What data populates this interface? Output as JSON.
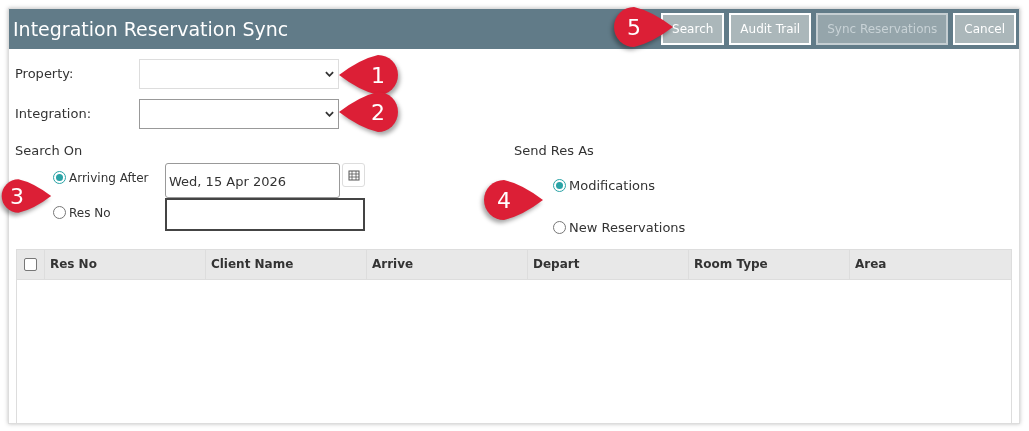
{
  "window": {
    "title": "Integration Reservation Sync"
  },
  "toolbar": [
    {
      "label": "Search",
      "disabled": false
    },
    {
      "label": "Audit Trail",
      "disabled": false
    },
    {
      "label": "Sync Reservations",
      "disabled": true
    },
    {
      "label": "Cancel",
      "disabled": false
    }
  ],
  "fields": [
    {
      "label": "Property:",
      "kind": "select"
    },
    {
      "label": "Integration:",
      "kind": "select"
    }
  ],
  "search_on": {
    "heading": "Search On",
    "options": [
      {
        "label": "Arriving After",
        "selected": true,
        "value": "Wed, 15 Apr 2026",
        "kind": "date"
      },
      {
        "label": "Res No",
        "selected": false,
        "kind": "text"
      }
    ]
  },
  "send_res_as": {
    "heading": "Send Res As",
    "options": [
      {
        "label": "Modifications",
        "selected": true
      },
      {
        "label": "New Reservations",
        "selected": false
      }
    ]
  },
  "table": {
    "select_all": {
      "checked": false
    },
    "columns": [
      "Res No",
      "Client Name",
      "Arrive",
      "Depart",
      "Room Type",
      "Area"
    ]
  },
  "callouts": [
    {
      "label": "1"
    },
    {
      "label": "2"
    },
    {
      "label": "3"
    },
    {
      "label": "4"
    },
    {
      "label": "5"
    }
  ]
}
